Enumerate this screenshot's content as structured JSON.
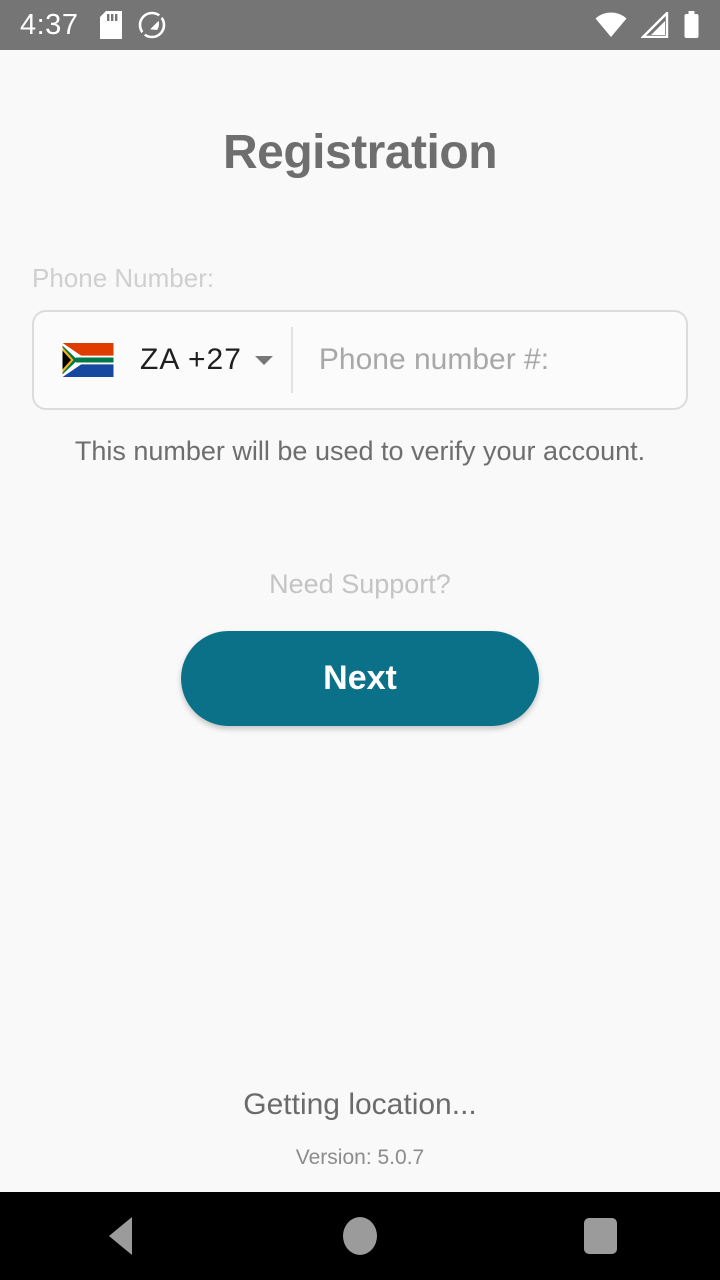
{
  "status_bar": {
    "time": "4:37",
    "left_icons": [
      "sd-card-icon",
      "do-not-disturb-icon"
    ],
    "right_icons": [
      "wifi-icon",
      "cellular-signal-icon",
      "battery-icon"
    ],
    "background_color": "#757575",
    "foreground_color": "#ffffff"
  },
  "header": {
    "title": "Registration"
  },
  "form": {
    "phone_label": "Phone Number:",
    "country": {
      "flag": "south-africa-flag-icon",
      "code_label": "ZA  +27",
      "iso": "ZA",
      "dial_code": "+27",
      "dropdown_icon": "chevron-down-icon"
    },
    "phone_input": {
      "value": "",
      "placeholder": "Phone number #:"
    },
    "helper_text": "This number will be used to verify your account."
  },
  "actions": {
    "support_link": "Need Support?",
    "next_label": "Next",
    "accent_color": "#0b7189"
  },
  "footer": {
    "location_status": "Getting location...",
    "version": "Version: 5.0.7"
  },
  "nav_bar": {
    "back": "back-button",
    "home": "home-button",
    "recents": "recents-button",
    "background_color": "#000000"
  }
}
